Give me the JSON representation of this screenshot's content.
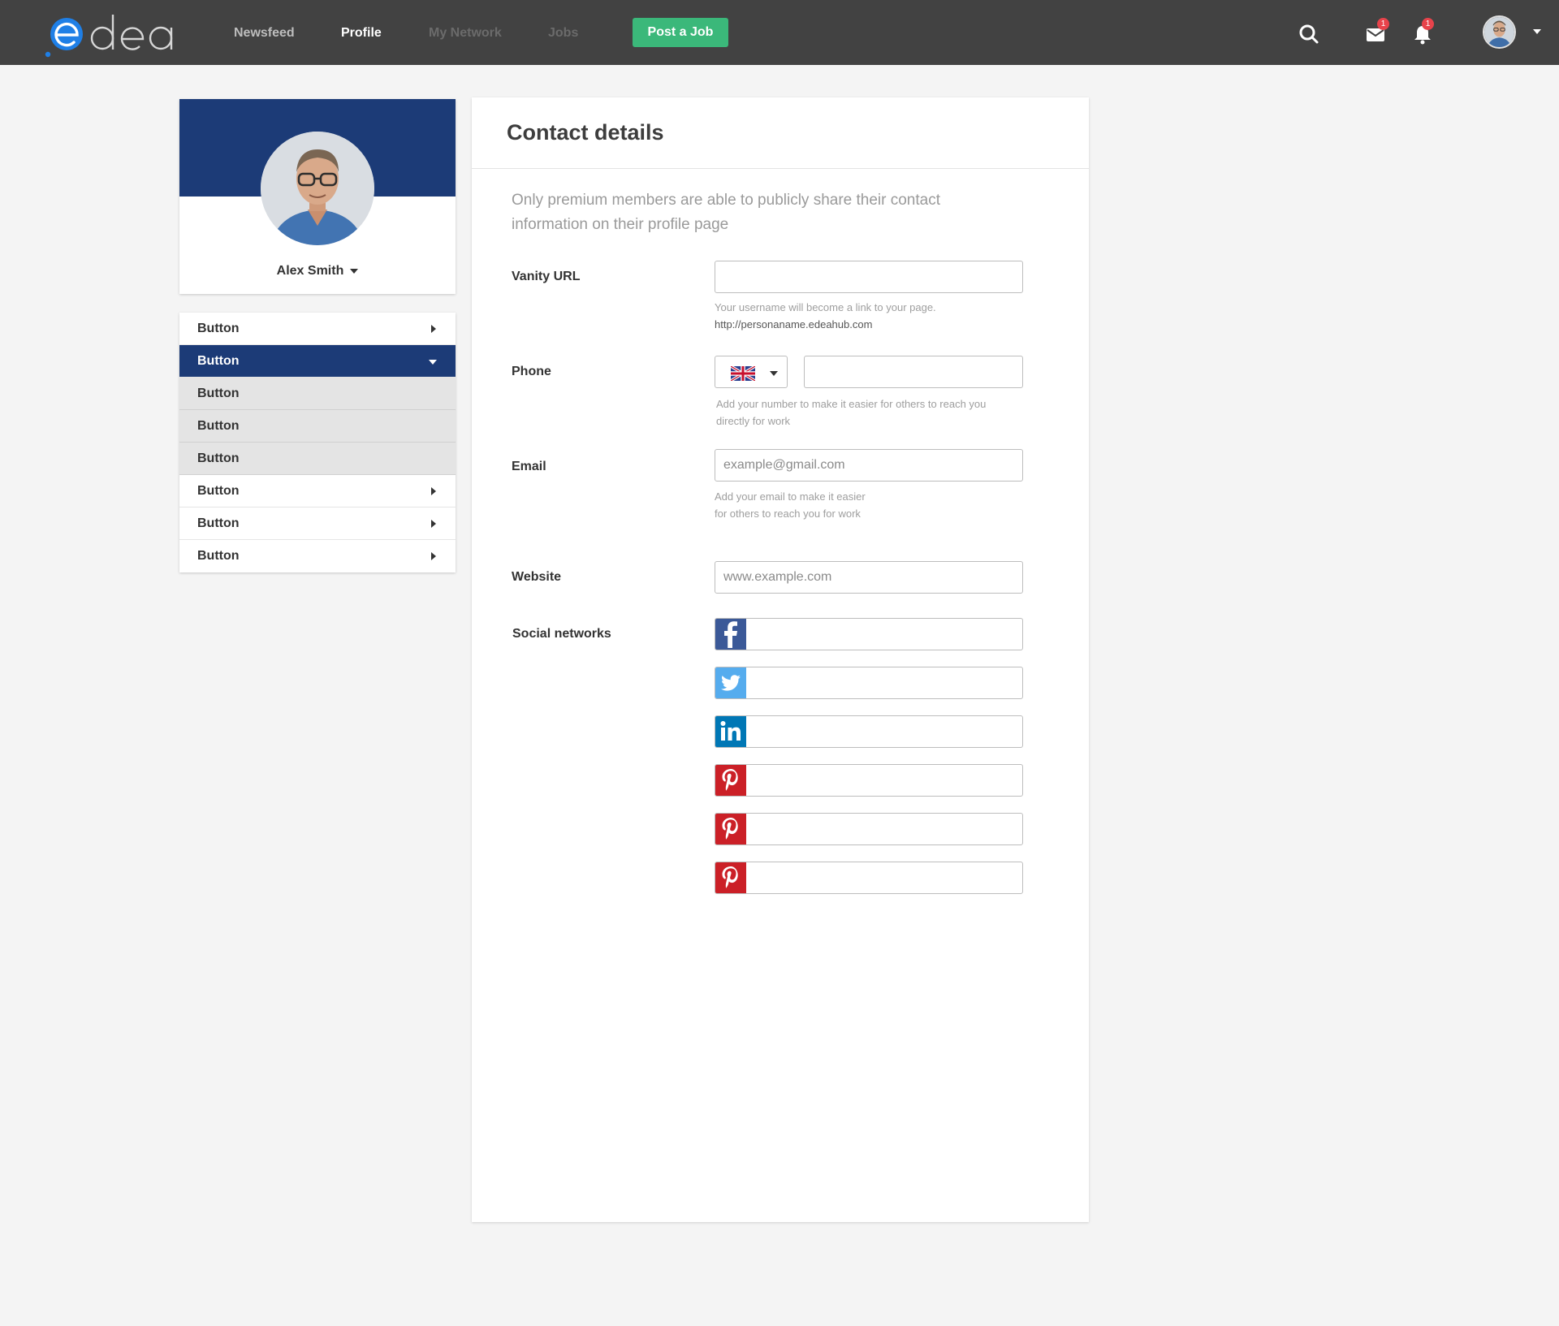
{
  "nav": {
    "items": [
      {
        "label": "Newsfeed"
      },
      {
        "label": "Profile"
      },
      {
        "label": "My Network"
      },
      {
        "label": "Jobs"
      }
    ],
    "post_job_label": "Post a Job",
    "mail_badge": "1",
    "bell_badge": "1",
    "accent_color": "#3bb87a"
  },
  "profile": {
    "name": "Alex Smith",
    "banner_color": "#1c3b77"
  },
  "menu": {
    "items": [
      {
        "label": "Button"
      },
      {
        "label": "Button"
      },
      {
        "label": "Button"
      },
      {
        "label": "Button"
      },
      {
        "label": "Button"
      },
      {
        "label": "Button"
      },
      {
        "label": "Button"
      },
      {
        "label": "Button"
      }
    ]
  },
  "contact": {
    "title": "Contact details",
    "intro": "Only premium members are able to publicly share their contact information on their profile page",
    "vanity": {
      "label": "Vanity URL",
      "value": "",
      "help": "Your username will become a link to your page.",
      "link": "http://personaname.edeahub.com"
    },
    "phone": {
      "label": "Phone",
      "value": "",
      "country_icon": "uk-flag-icon",
      "help_line1": "Add your number to make it easier for others to reach you",
      "help_line2": "directly for work"
    },
    "email": {
      "label": "Email",
      "placeholder": "example@gmail.com",
      "help_line1": "Add your email to make it easier",
      "help_line2": "for others to reach you for work"
    },
    "website": {
      "label": "Website",
      "placeholder": "www.example.com"
    },
    "social": {
      "label": "Social networks",
      "networks": [
        {
          "icon": "facebook-icon",
          "value": ""
        },
        {
          "icon": "twitter-icon",
          "value": ""
        },
        {
          "icon": "linkedin-icon",
          "value": ""
        },
        {
          "icon": "pinterest-icon",
          "value": ""
        },
        {
          "icon": "pinterest-icon",
          "value": ""
        },
        {
          "icon": "pinterest-icon",
          "value": ""
        }
      ]
    }
  }
}
